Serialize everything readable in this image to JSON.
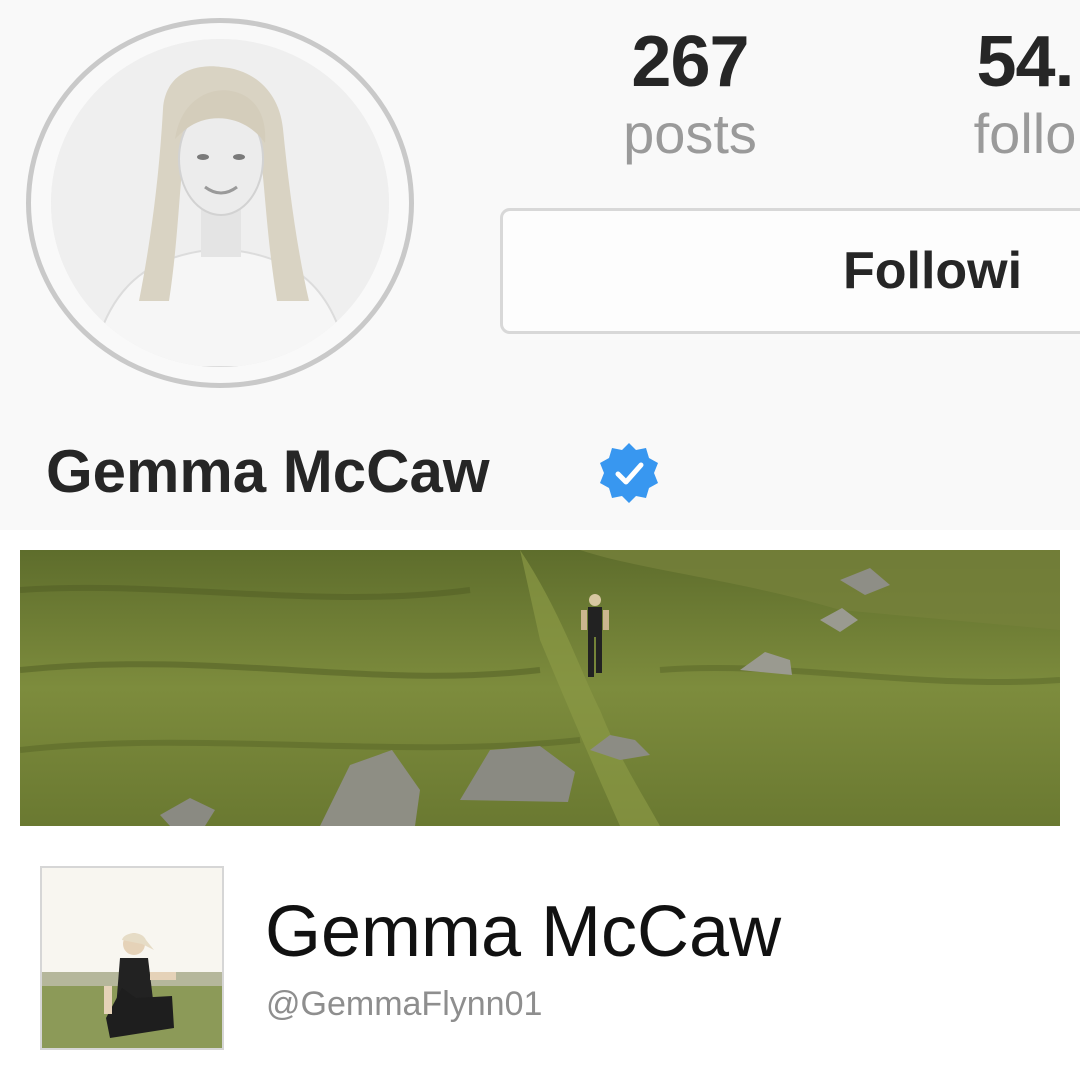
{
  "profile": {
    "name": "Gemma McCaw",
    "verified": true
  },
  "stats": {
    "posts": {
      "count": "267",
      "label": "posts"
    },
    "followers": {
      "count": "54.",
      "label": "follo"
    }
  },
  "actions": {
    "follow_label": "Followi"
  },
  "card": {
    "name": "Gemma McCaw",
    "handle": "@GemmaFlynn01"
  },
  "colors": {
    "verified_badge": "#3897f0",
    "background": "#f9f9f9",
    "text_primary": "#262626",
    "text_secondary": "#9a9a9a",
    "grass": "#6f7f35"
  }
}
